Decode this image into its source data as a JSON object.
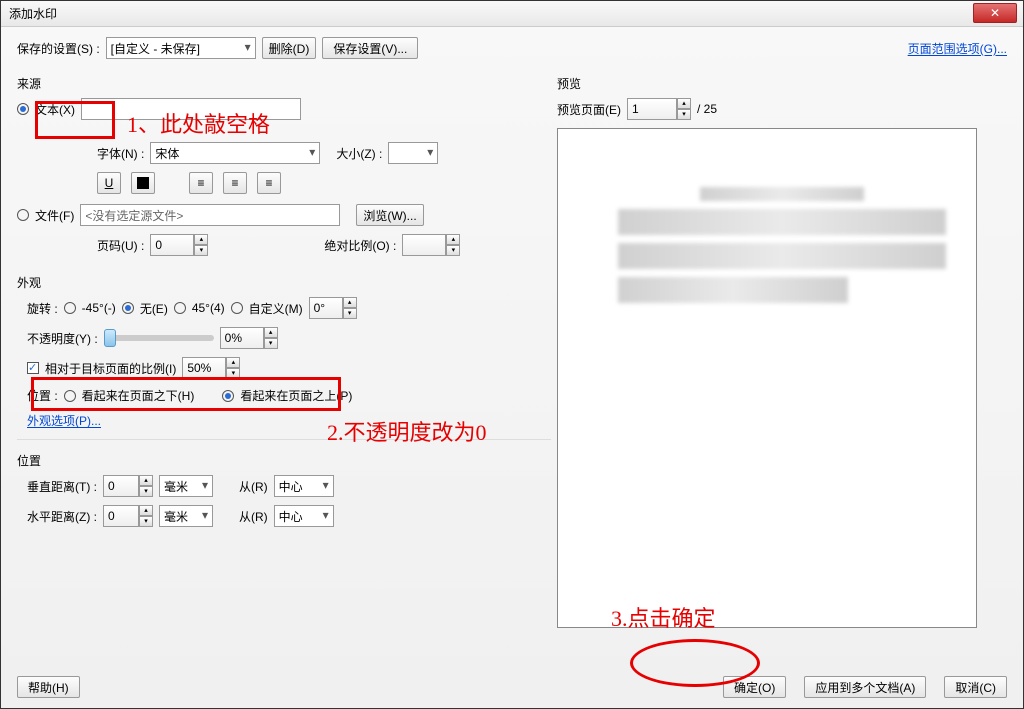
{
  "window_title": "添加水印",
  "top": {
    "saved_settings_label": "保存的设置(S) :",
    "saved_settings_value": "[自定义 - 未保存]",
    "delete_btn": "删除(D)",
    "save_settings_btn": "保存设置(V)...",
    "page_range_link": "页面范围选项(G)..."
  },
  "source": {
    "title": "来源",
    "text_radio": "文本(X)",
    "text_value": "",
    "font_label": "字体(N) :",
    "font_value": "宋体",
    "size_label": "大小(Z) :",
    "size_value": "",
    "file_radio": "文件(F)",
    "file_value": "<没有选定源文件>",
    "browse_btn": "浏览(W)...",
    "page_label": "页码(U) :",
    "page_value": "0",
    "abs_scale_label": "绝对比例(O) :"
  },
  "appearance": {
    "title": "外观",
    "rotate_label": "旋转 :",
    "rot_neg45": "-45°(-)",
    "rot_none": "无(E)",
    "rot_45": "45°(4)",
    "rot_custom": "自定义(M)",
    "rot_custom_value": "0°",
    "opacity_label": "不透明度(Y) :",
    "opacity_value": "0%",
    "rel_scale_check": "相对于目标页面的比例(I)",
    "rel_scale_value": "50%",
    "position_label": "位置 :",
    "behind": "看起来在页面之下(H)",
    "above": "看起来在页面之上(P)",
    "appearance_options_link": "外观选项(P)..."
  },
  "placement": {
    "title": "位置",
    "vdist_label": "垂直距离(T) :",
    "vdist_value": "0",
    "vdist_unit": "毫米",
    "hdist_label": "水平距离(Z) :",
    "hdist_value": "0",
    "hdist_unit": "毫米",
    "from_label": "从(R)",
    "from_value": "中心"
  },
  "preview": {
    "title": "预览",
    "page_label": "预览页面(E)",
    "page_value": "1",
    "page_total": "/ 25"
  },
  "footer": {
    "help": "帮助(H)",
    "ok": "确定(O)",
    "apply_multi": "应用到多个文档(A)",
    "cancel": "取消(C)"
  },
  "annotations": {
    "a1": "1、此处敲空格",
    "a2": "2.不透明度改为0",
    "a3": "3.点击确定"
  }
}
